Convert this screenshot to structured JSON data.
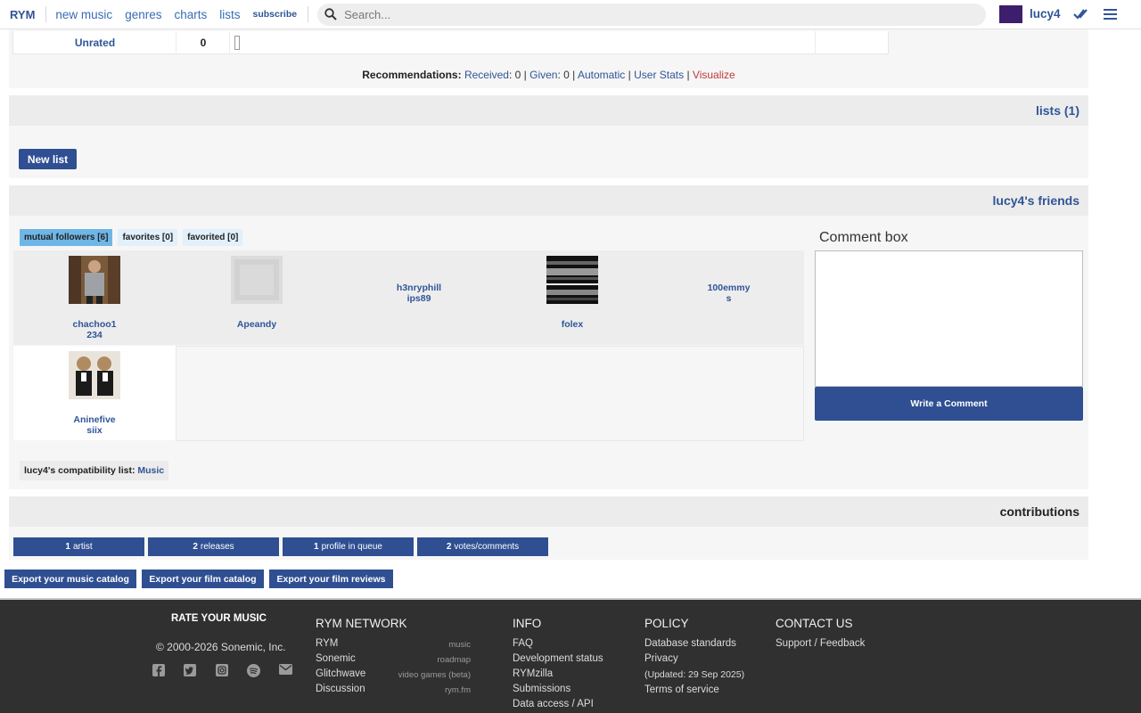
{
  "nav": {
    "logo": "RYM",
    "links": [
      "new music",
      "genres",
      "charts",
      "lists"
    ],
    "subscribe": "subscribe",
    "search_placeholder": "Search...",
    "username": "lucy4"
  },
  "ratings": {
    "label": "Unrated",
    "count": "0"
  },
  "recommendations": {
    "label": "Recommendations:",
    "received_label": "Received",
    "received_value": ": 0 | ",
    "given_label": "Given",
    "given_value": ": 0 | ",
    "automatic": "Automatic",
    "sep": " | ",
    "user_stats": "User Stats",
    "visualize": "Visualize"
  },
  "lists_section": {
    "title": "lists (1)",
    "new_list": "New list"
  },
  "friends_section": {
    "title": "lucy4's friends",
    "tabs": [
      "mutual followers [6]",
      "favorites [0]",
      "favorited [0]"
    ],
    "friends": [
      {
        "name_l1": "chachoo1",
        "name_l2": "234"
      },
      {
        "name_l1": "Apeandy",
        "name_l2": ""
      },
      {
        "name_l1": "h3nryphill",
        "name_l2": "ips89"
      },
      {
        "name_l1": "folex",
        "name_l2": ""
      },
      {
        "name_l1": "100emmy",
        "name_l2": "s"
      },
      {
        "name_l1": "Aninefive",
        "name_l2": "siix"
      }
    ],
    "compat_label": "lucy4's compatibility list:",
    "compat_link": "Music",
    "comment_title": "Comment box",
    "write_comment": "Write a Comment"
  },
  "contributions": {
    "title": "contributions",
    "items": [
      {
        "count": "1",
        "label": "artist"
      },
      {
        "count": "2",
        "label": "releases"
      },
      {
        "count": "1",
        "label": "profile in queue"
      },
      {
        "count": "2",
        "label": "votes/comments"
      }
    ]
  },
  "exports": [
    "Export your music catalog",
    "Export your film catalog",
    "Export your film reviews"
  ],
  "footer": {
    "brand": "RATE YOUR MUSIC",
    "copyright": "© 2000-2026 Sonemic, Inc.",
    "network_title": "RYM NETWORK",
    "network": [
      {
        "name": "RYM",
        "desc": "music"
      },
      {
        "name": "Sonemic",
        "desc": "roadmap"
      },
      {
        "name": "Glitchwave",
        "desc": "video games (beta)"
      },
      {
        "name": "Discussion",
        "desc": "rym.fm"
      }
    ],
    "info_title": "INFO",
    "info": [
      "FAQ",
      "Development status",
      "RYMzilla",
      "Submissions",
      "Data access / API"
    ],
    "policy_title": "POLICY",
    "policy": [
      "Database standards",
      "Privacy",
      "(Updated: 29 Sep 2025)",
      "Terms of service"
    ],
    "contact_title": "CONTACT US",
    "contact": [
      "Support / Feedback"
    ]
  },
  "colors": {
    "brand_blue": "#2f4f92",
    "link_blue": "#2f5597",
    "accent_red": "#c0393b",
    "footer_bg": "#303030"
  }
}
